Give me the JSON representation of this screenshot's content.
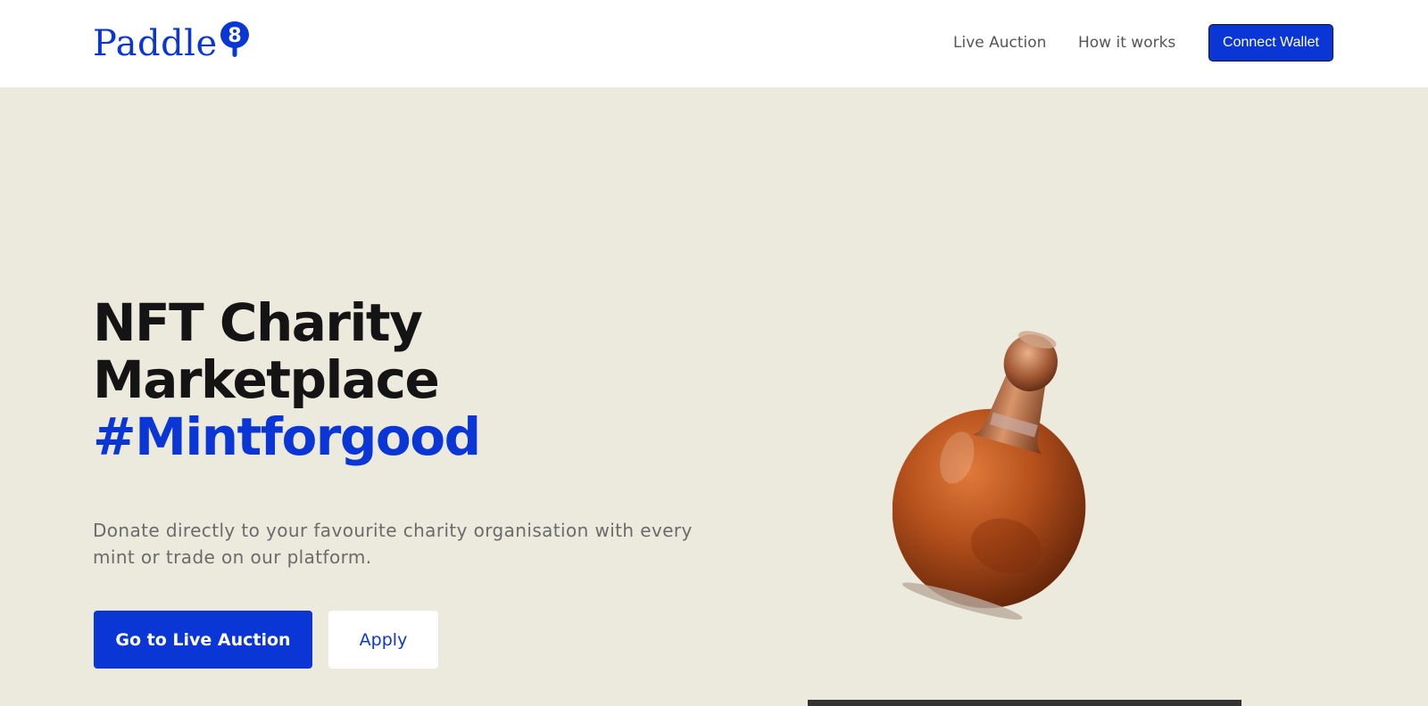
{
  "header": {
    "logo_text": "Paddle",
    "logo_badge": "8",
    "nav": {
      "live_auction": "Live Auction",
      "how_it_works": "How it works"
    },
    "connect_wallet": "Connect Wallet"
  },
  "hero": {
    "title_line1": "NFT Charity",
    "title_line2": "Marketplace",
    "hashtag": "#Mintforgood",
    "subtitle": "Donate directly to your favourite charity organisation with every mint or trade on our platform.",
    "primary_button": "Go to Live Auction",
    "secondary_button": "Apply"
  },
  "colors": {
    "brand_blue": "#0a36d6",
    "background": "#ece9dd",
    "header_bg": "#ffffff"
  },
  "icons": [
    "paddle-logo-badge",
    "bottle-illustration"
  ]
}
